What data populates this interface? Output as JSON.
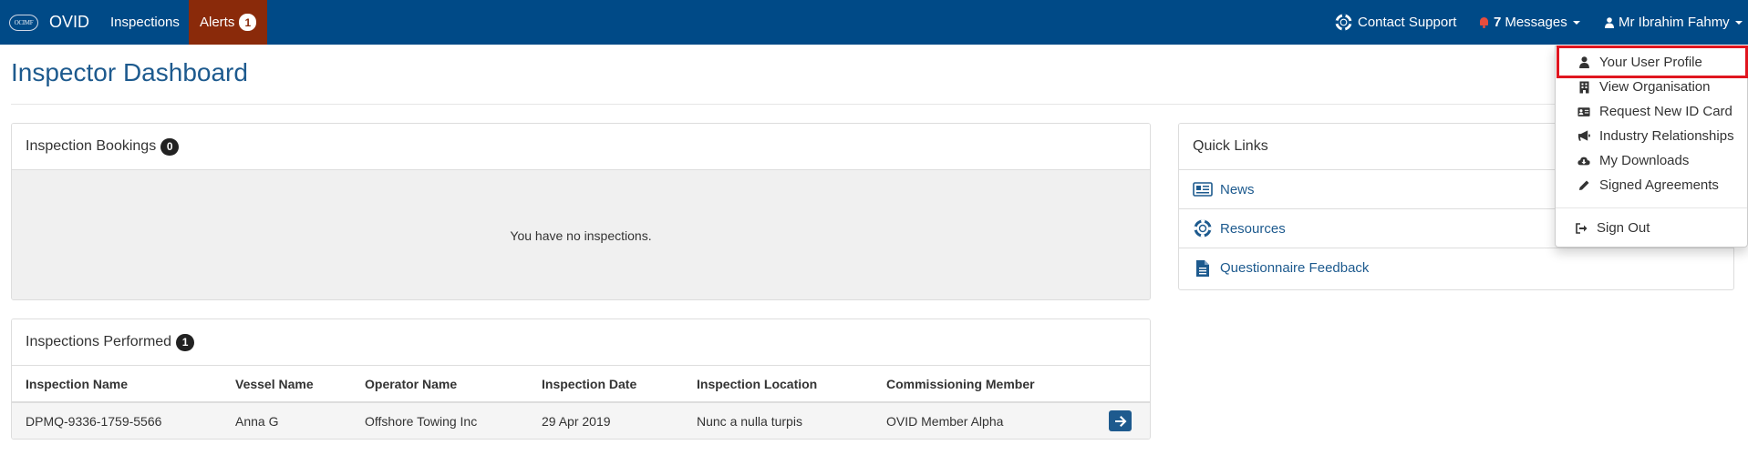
{
  "navbar": {
    "logo_text": "OCIMF",
    "brand": "OVID",
    "inspections": "Inspections",
    "alerts": "Alerts",
    "alerts_count": "1",
    "contact_support": "Contact Support",
    "messages_count": "7",
    "messages": "Messages",
    "user_name": "Mr Ibrahim Fahmy"
  },
  "page": {
    "title": "Inspector Dashboard"
  },
  "bookings": {
    "title": "Inspection Bookings",
    "count": "0",
    "empty_text": "You have no inspections."
  },
  "performed": {
    "title": "Inspections Performed",
    "count": "1",
    "columns": [
      "Inspection Name",
      "Vessel Name",
      "Operator Name",
      "Inspection Date",
      "Inspection Location",
      "Commissioning Member"
    ],
    "rows": [
      [
        "DPMQ-9336-1759-5566",
        "Anna G",
        "Offshore Towing Inc",
        "29 Apr 2019",
        "Nunc a nulla turpis",
        "OVID Member Alpha"
      ]
    ]
  },
  "quick_links": {
    "title": "Quick Links",
    "items": [
      {
        "label": "News",
        "icon": "newspaper-icon"
      },
      {
        "label": "Resources",
        "icon": "lifebuoy-icon"
      },
      {
        "label": "Questionnaire Feedback",
        "icon": "document-icon"
      }
    ]
  },
  "user_menu": {
    "items": [
      {
        "label": "Your User Profile",
        "icon": "user-icon"
      },
      {
        "label": "View Organisation",
        "icon": "building-icon"
      },
      {
        "label": "Request New ID Card",
        "icon": "id-card-icon"
      },
      {
        "label": "Industry Relationships",
        "icon": "megaphone-icon"
      },
      {
        "label": "My Downloads",
        "icon": "cloud-download-icon"
      },
      {
        "label": "Signed Agreements",
        "icon": "pencil-icon"
      }
    ],
    "sign_out": "Sign Out"
  },
  "colors": {
    "navbar": "#004a87",
    "alerts_bg": "#8a2a0a",
    "link": "#1d5a8e",
    "highlight": "#e0151f"
  }
}
